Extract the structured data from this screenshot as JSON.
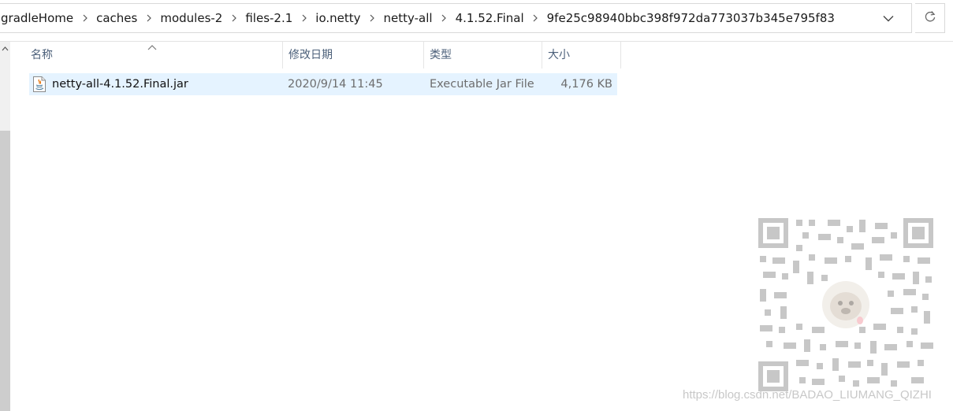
{
  "address_bar": {
    "crumbs": [
      "gradleHome",
      "caches",
      "modules-2",
      "files-2.1",
      "io.netty",
      "netty-all",
      "4.1.52.Final",
      "9fe25c98940bbc398f972da773037b345e795f83"
    ],
    "separator_icon": "chevron-right-icon",
    "dropdown_icon": "chevron-down-icon",
    "refresh_icon": "refresh-icon"
  },
  "columns": {
    "name": "名称",
    "date": "修改日期",
    "type": "类型",
    "size": "大小",
    "sorted_by": "name"
  },
  "files": [
    {
      "name": "netty-all-4.1.52.Final.jar",
      "modified": "2020/9/14 11:45",
      "type": "Executable Jar File",
      "size": "4,176 KB",
      "icon": "java-jar-icon",
      "selected": true
    }
  ],
  "watermark": {
    "text": "https://blog.csdn.net/BADAO_LIUMANG_QIZHI"
  },
  "colors": {
    "selection_bg": "#e5f3ff",
    "header_text": "#4c607a",
    "secondary_text": "#6d6d6d"
  }
}
